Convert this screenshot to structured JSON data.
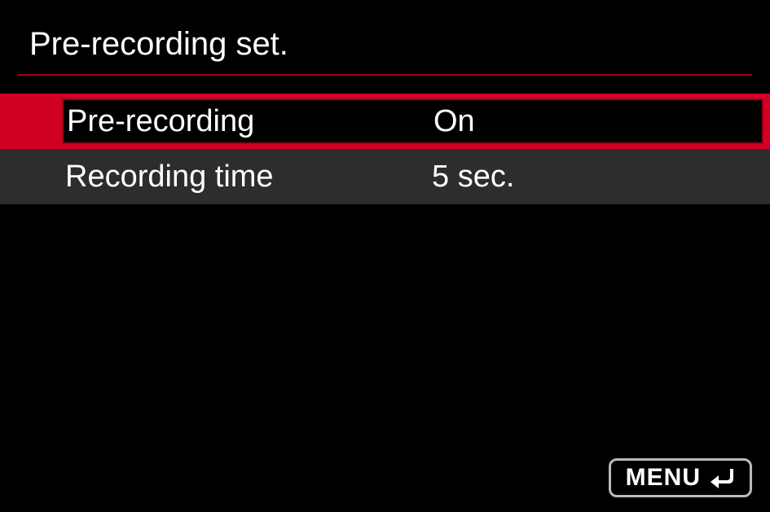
{
  "header": {
    "title": "Pre-recording set."
  },
  "menu": {
    "items": [
      {
        "label": "Pre-recording",
        "value": "On",
        "selected": true
      },
      {
        "label": "Recording time",
        "value": "5 sec.",
        "selected": false
      }
    ]
  },
  "footer": {
    "menu_label": "MENU"
  }
}
